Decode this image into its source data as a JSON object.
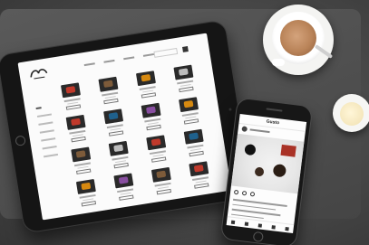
{
  "scene": {
    "background_color": "#4a4a4a",
    "objects": [
      "tablet",
      "smartphone",
      "coffee-cup",
      "milk-cup"
    ]
  },
  "tablet": {
    "device": "tablet",
    "site": {
      "nav_link_count": 4,
      "sidebar_item_count": 7,
      "products": [
        {
          "color": "c1"
        },
        {
          "color": "c3"
        },
        {
          "color": "c2"
        },
        {
          "color": "c6"
        },
        {
          "color": "c1"
        },
        {
          "color": "c4"
        },
        {
          "color": "c5"
        },
        {
          "color": "c2"
        },
        {
          "color": "c3"
        },
        {
          "color": "c6"
        },
        {
          "color": "c1"
        },
        {
          "color": "c4"
        },
        {
          "color": "c2"
        },
        {
          "color": "c5"
        },
        {
          "color": "c3"
        },
        {
          "color": "c1"
        },
        {
          "color": "c6"
        },
        {
          "color": "c2"
        },
        {
          "color": "c4"
        },
        {
          "color": "c3"
        }
      ]
    }
  },
  "phone": {
    "device": "smartphone",
    "app": {
      "brand": "Gusto"
    }
  },
  "coffee": {
    "cup_color": "#ffffff",
    "coffee_color": "#b98358",
    "milk_color": "#f0e0b0"
  }
}
